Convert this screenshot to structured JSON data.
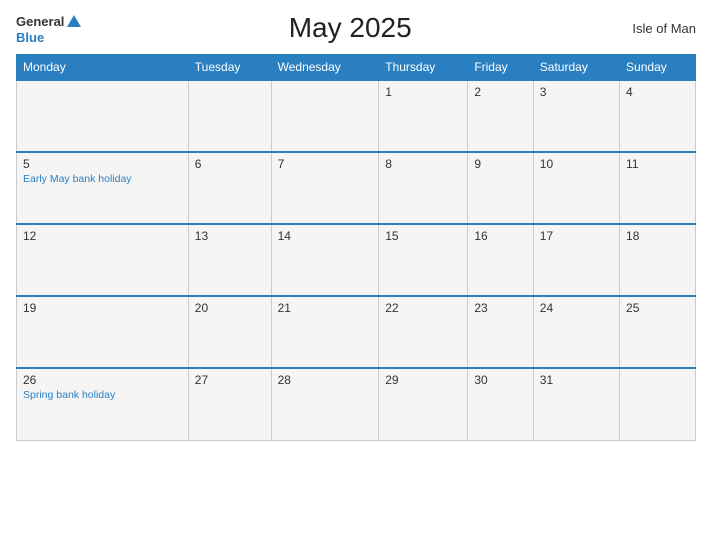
{
  "header": {
    "logo_general": "General",
    "logo_blue": "Blue",
    "title": "May 2025",
    "region": "Isle of Man"
  },
  "columns": [
    "Monday",
    "Tuesday",
    "Wednesday",
    "Thursday",
    "Friday",
    "Saturday",
    "Sunday"
  ],
  "weeks": [
    [
      {
        "day": "",
        "event": ""
      },
      {
        "day": "",
        "event": ""
      },
      {
        "day": "",
        "event": ""
      },
      {
        "day": "1",
        "event": ""
      },
      {
        "day": "2",
        "event": ""
      },
      {
        "day": "3",
        "event": ""
      },
      {
        "day": "4",
        "event": ""
      }
    ],
    [
      {
        "day": "5",
        "event": "Early May bank holiday"
      },
      {
        "day": "6",
        "event": ""
      },
      {
        "day": "7",
        "event": ""
      },
      {
        "day": "8",
        "event": ""
      },
      {
        "day": "9",
        "event": ""
      },
      {
        "day": "10",
        "event": ""
      },
      {
        "day": "11",
        "event": ""
      }
    ],
    [
      {
        "day": "12",
        "event": ""
      },
      {
        "day": "13",
        "event": ""
      },
      {
        "day": "14",
        "event": ""
      },
      {
        "day": "15",
        "event": ""
      },
      {
        "day": "16",
        "event": ""
      },
      {
        "day": "17",
        "event": ""
      },
      {
        "day": "18",
        "event": ""
      }
    ],
    [
      {
        "day": "19",
        "event": ""
      },
      {
        "day": "20",
        "event": ""
      },
      {
        "day": "21",
        "event": ""
      },
      {
        "day": "22",
        "event": ""
      },
      {
        "day": "23",
        "event": ""
      },
      {
        "day": "24",
        "event": ""
      },
      {
        "day": "25",
        "event": ""
      }
    ],
    [
      {
        "day": "26",
        "event": "Spring bank holiday"
      },
      {
        "day": "27",
        "event": ""
      },
      {
        "day": "28",
        "event": ""
      },
      {
        "day": "29",
        "event": ""
      },
      {
        "day": "30",
        "event": ""
      },
      {
        "day": "31",
        "event": ""
      },
      {
        "day": "",
        "event": ""
      }
    ]
  ]
}
